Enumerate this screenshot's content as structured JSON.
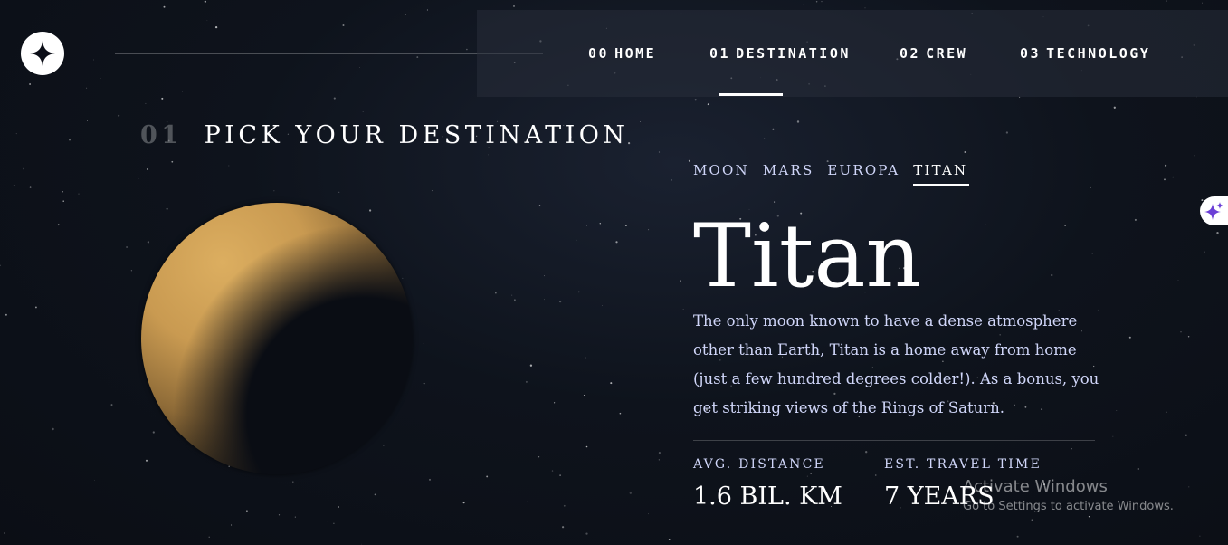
{
  "nav": {
    "items": [
      {
        "num": "00",
        "label": "HOME"
      },
      {
        "num": "01",
        "label": "DESTINATION"
      },
      {
        "num": "02",
        "label": "CREW"
      },
      {
        "num": "03",
        "label": "TECHNOLOGY"
      }
    ],
    "active_index": 1
  },
  "page_heading": {
    "num": "01",
    "label": "PICK YOUR DESTINATION"
  },
  "destinations": {
    "tabs": [
      "MOON",
      "MARS",
      "EUROPA",
      "TITAN"
    ],
    "active": "TITAN"
  },
  "planet": {
    "name": "Titan",
    "description": "The only moon known to have a dense atmosphere other than Earth, Titan is a home away from home (just a few hundred degrees colder!). As a bonus, you get striking views of the Rings of Saturn.",
    "distance_label": "AVG. DISTANCE",
    "distance_value": "1.6 BIL. KM",
    "travel_label": "EST. TRAVEL TIME",
    "travel_value": "7 YEARS"
  },
  "icons": {
    "logo": "star-logo-icon",
    "floating": "sparkle-icon"
  },
  "colors": {
    "accent_text": "#d0d6f9",
    "planet": "#d4a85c",
    "sparkle": "#6b3fd6"
  },
  "watermark": {
    "title": "Activate Windows",
    "subtitle": "Go to Settings to activate Windows."
  }
}
